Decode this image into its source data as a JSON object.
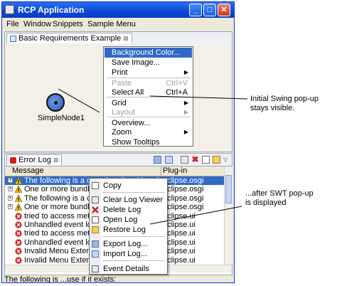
{
  "window": {
    "title": "RCP Application"
  },
  "titlebar_buttons": {
    "minimize": "_",
    "maximize": "□",
    "close": "✕"
  },
  "menubar": [
    "File",
    "Window",
    "Snippets",
    "Sample Menu"
  ],
  "editor": {
    "tab_label": "Basic Requirements Example",
    "tab_close": "⊠",
    "node_label": "SimpleNode1"
  },
  "swing_popup": {
    "items": [
      {
        "label": "Background Color...",
        "shortcut": "",
        "arrow": ""
      },
      {
        "label": "Save Image...",
        "shortcut": "",
        "arrow": ""
      },
      {
        "label": "Print",
        "shortcut": "",
        "arrow": "▶"
      },
      {
        "label": "Paste",
        "shortcut": "Ctrl+V",
        "arrow": ""
      },
      {
        "label": "Select All",
        "shortcut": "Ctrl+A",
        "arrow": ""
      },
      {
        "label": "Grid",
        "shortcut": "",
        "arrow": "▶"
      },
      {
        "label": "Layout",
        "shortcut": "",
        "arrow": "▶"
      },
      {
        "label": "Overview...",
        "shortcut": "",
        "arrow": ""
      },
      {
        "label": "Zoom",
        "shortcut": "",
        "arrow": "▶"
      },
      {
        "label": "Show Tooltips",
        "shortcut": "",
        "arrow": ""
      }
    ]
  },
  "error_log": {
    "tab_label": "Error Log",
    "tab_close": "⊠",
    "columns": {
      "message": "Message",
      "plugin": "Plug-in"
    },
    "rows": [
      {
        "message": "The following is a complete list of bundles whi",
        "plugin": "eclipse.osgi",
        "icon": "warning-icon"
      },
      {
        "message": "One or more bundles are not resolved",
        "plugin": "eclipse.osgi",
        "icon": "warning-icon"
      },
      {
        "message": "The following is a complete list of bundles",
        "plugin": "eclipse.osgi",
        "icon": "warning-icon"
      },
      {
        "message": "One or more bundles are not resolved",
        "plugin": "eclipse.osgi",
        "icon": "warning-icon"
      },
      {
        "message": "tried to access method",
        "plugin": "eclipse.ui",
        "icon": "error-icon"
      },
      {
        "message": "Unhandled event loop exception",
        "plugin": "eclipse.ui",
        "icon": "error-icon"
      },
      {
        "message": "tried to access method",
        "plugin": "eclipse.ui",
        "icon": "error-icon"
      },
      {
        "message": "Unhandled event loop exception",
        "plugin": "eclipse.ui",
        "icon": "error-icon"
      },
      {
        "message": "Invalid Menu Extension",
        "plugin": "eclipse.ui",
        "icon": "error-icon"
      },
      {
        "message": "Invalid Menu Extension",
        "plugin": "eclipse.ui",
        "icon": "error-icon"
      }
    ],
    "status": "The following is ...use if it exists:"
  },
  "swt_popup": {
    "items": [
      {
        "label": "Copy",
        "icon": "copy-icon"
      },
      {
        "label": "Clear Log Viewer",
        "icon": "clear-log-icon"
      },
      {
        "label": "Delete Log",
        "icon": "delete-log-icon"
      },
      {
        "label": "Open Log",
        "icon": "open-log-icon"
      },
      {
        "label": "Restore Log",
        "icon": "restore-log-icon"
      },
      {
        "label": "Export Log...",
        "icon": "export-log-icon"
      },
      {
        "label": "Import Log...",
        "icon": "import-log-icon"
      },
      {
        "label": "Event Details",
        "icon": "event-details-icon"
      }
    ]
  },
  "annotations": {
    "swing_note_line1": "Initial Swing pop-up",
    "swing_note_line2": "stays visible.",
    "swt_note_line1": "...after SWT pop-up",
    "swt_note_line2": "is displayed"
  },
  "colors": {
    "titlebar": "#0a46d6",
    "selection": "#316ac5",
    "error_red": "#d02020",
    "warning_yellow": "#f0c020"
  }
}
